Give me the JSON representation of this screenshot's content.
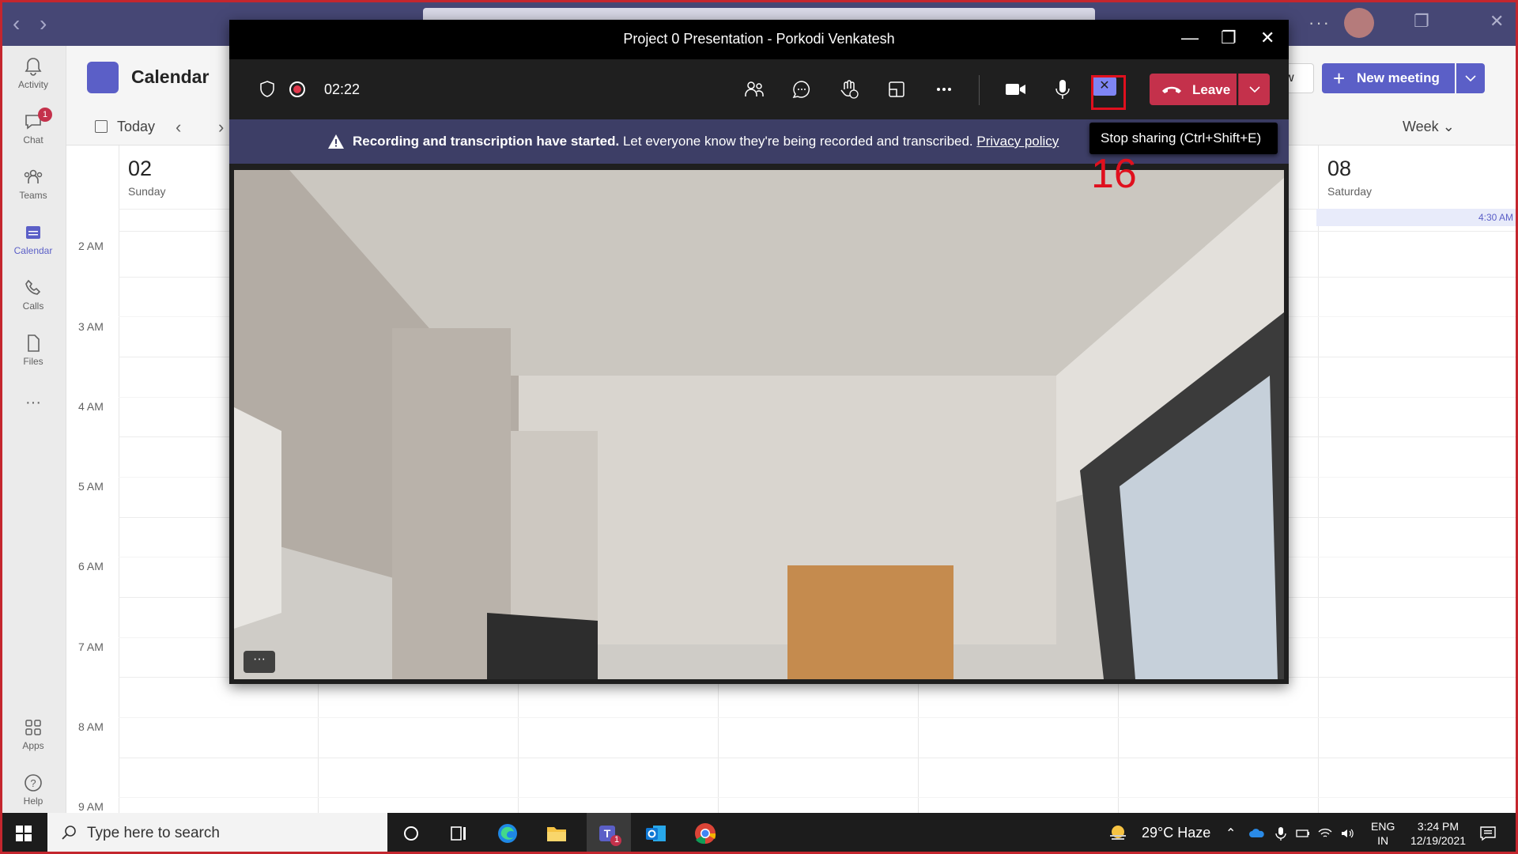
{
  "meeting": {
    "title": "Project 0 Presentation - Porkodi Venkatesh",
    "timer": "02:22",
    "leave_label": "Leave",
    "banner_bold": "Recording and transcription have started.",
    "banner_text": " Let everyone know they're being recorded and transcribed. ",
    "banner_link": "Privacy policy",
    "tooltip": "Stop sharing (Ctrl+Shift+E)",
    "step_number": "16",
    "more_label": "···",
    "accent_color": "#c4314b",
    "icons": [
      "shield-icon",
      "record-icon",
      "participants-icon",
      "chat-icon",
      "reactions-icon",
      "rooms-icon",
      "more-icon",
      "camera-icon",
      "mic-icon",
      "stop-share-icon",
      "phone-hangup-icon",
      "chevron-down-icon"
    ]
  },
  "teams": {
    "rail": [
      {
        "label": "Activity",
        "icon": "bell-icon"
      },
      {
        "label": "Chat",
        "icon": "chat-icon",
        "badge": "1"
      },
      {
        "label": "Teams",
        "icon": "teams-icon"
      },
      {
        "label": "Calendar",
        "icon": "calendar-icon",
        "active": true
      },
      {
        "label": "Calls",
        "icon": "phone-icon"
      },
      {
        "label": "Files",
        "icon": "file-icon"
      },
      {
        "label": "···",
        "icon": "more-icon"
      },
      {
        "label": "Apps",
        "icon": "apps-icon"
      },
      {
        "label": "Help",
        "icon": "help-icon"
      }
    ],
    "calendar_title": "Calendar",
    "today_label": "Today",
    "week_label": "Week",
    "new_meeting_label": "New meeting",
    "meet_now_stub": "w",
    "days": [
      {
        "num": "02",
        "name": "Sunday"
      },
      {
        "num": "08",
        "name": "Saturday"
      }
    ],
    "allday_time": "4:30 AM",
    "times": [
      "2 AM",
      "3 AM",
      "4 AM",
      "5 AM",
      "6 AM",
      "7 AM",
      "8 AM",
      "9 AM"
    ]
  },
  "taskbar": {
    "search_placeholder": "Type here to search",
    "weather": "29°C  Haze",
    "lang_line1": "ENG",
    "lang_line2": "IN",
    "time": "3:24 PM",
    "date": "12/19/2021",
    "teams_badge": "1"
  }
}
